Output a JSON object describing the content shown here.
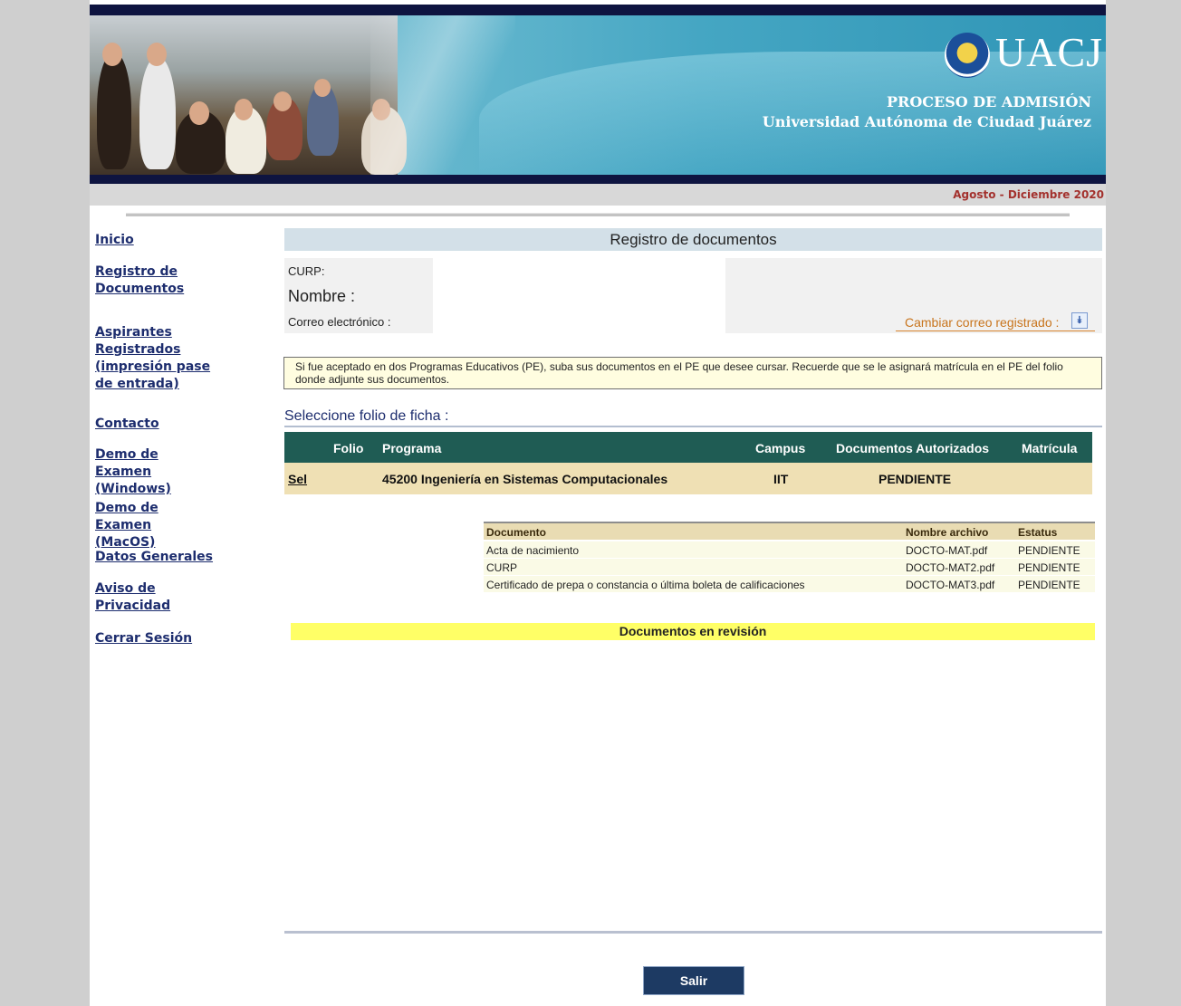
{
  "header": {
    "logo_text": "UACJ",
    "proceso": "PROCESO DE ADMISIÓN",
    "universidad": "Universidad Autónoma de Ciudad Juárez",
    "periodo": "Agosto - Diciembre 2020"
  },
  "sidebar": {
    "items": [
      {
        "label": "Inicio"
      },
      {
        "label": "Registro de Documentos"
      },
      {
        "label": "Aspirantes Registrados (impresión pase de entrada)"
      },
      {
        "label": "Contacto"
      },
      {
        "label": "Demo de Examen (Windows)"
      },
      {
        "label": "Demo de Examen (MacOS)"
      },
      {
        "label": "Datos Generales"
      },
      {
        "label": "Aviso de Privacidad"
      },
      {
        "label": "Cerrar Sesión"
      }
    ]
  },
  "main": {
    "title": "Registro de documentos",
    "curp_label": "CURP:",
    "nombre_label": "Nombre :",
    "correo_label": "Correo electrónico :",
    "cambiar_correo": "Cambiar correo registrado :",
    "notice": "Si fue aceptado en dos Programas Educativos (PE), suba sus documentos en el PE que desee cursar. Recuerde que se le asignará matrícula en el PE del folio donde adjunte sus documentos.",
    "seleccione": "Seleccione folio de ficha :",
    "folio_table": {
      "headers": {
        "folio": "Folio",
        "programa": "Programa",
        "campus": "Campus",
        "docs": "Documentos Autorizados",
        "matricula": "Matrícula"
      },
      "row": {
        "sel": "Sel",
        "programa": "45200 Ingeniería en Sistemas Computacionales",
        "campus": "IIT",
        "docs": "PENDIENTE",
        "matricula": ""
      }
    },
    "doc_table": {
      "headers": {
        "documento": "Documento",
        "archivo": "Nombre archivo",
        "estatus": "Estatus"
      },
      "rows": [
        {
          "documento": "Acta de nacimiento",
          "archivo": "DOCTO-MAT.pdf",
          "estatus": "PENDIENTE"
        },
        {
          "documento": "CURP",
          "archivo": "DOCTO-MAT2.pdf",
          "estatus": "PENDIENTE"
        },
        {
          "documento": "Certificado de prepa o constancia o última boleta de calificaciones",
          "archivo": "DOCTO-MAT3.pdf",
          "estatus": "PENDIENTE"
        }
      ]
    },
    "revision": "Documentos en revisión",
    "salir": "Salir"
  },
  "colors": {
    "nav_link": "#1d2d6e",
    "table_header": "#1f5c54",
    "selected_row": "#efe0b4",
    "revision_bar": "#ffff66",
    "period_text": "#a3312d",
    "salir_button": "#1d3a63"
  }
}
